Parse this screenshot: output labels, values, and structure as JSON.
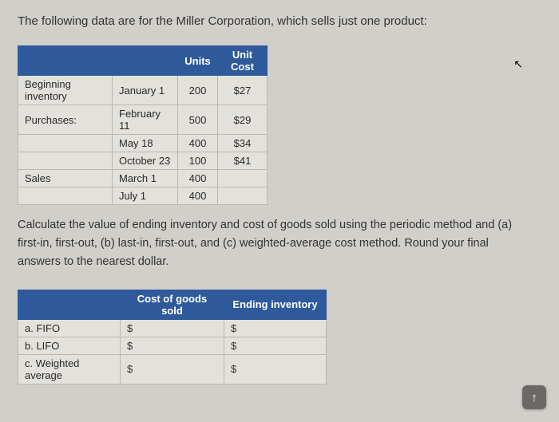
{
  "intro": "The following data are for the Miller Corporation, which sells just one product:",
  "table1": {
    "headers": {
      "units": "Units",
      "unit_cost": "Unit Cost"
    },
    "rows": [
      {
        "label": "Beginning inventory",
        "date": "January 1",
        "units": "200",
        "cost": "$27"
      },
      {
        "label": "Purchases:",
        "date": "February 11",
        "units": "500",
        "cost": "$29"
      },
      {
        "label": "",
        "date": "May 18",
        "units": "400",
        "cost": "$34"
      },
      {
        "label": "",
        "date": "October 23",
        "units": "100",
        "cost": "$41"
      },
      {
        "label": "Sales",
        "date": "March 1",
        "units": "400",
        "cost": ""
      },
      {
        "label": "",
        "date": "July 1",
        "units": "400",
        "cost": ""
      }
    ]
  },
  "question_lines": [
    "Calculate the value of ending inventory and cost of goods sold using the periodic method and (a)",
    "first-in, first-out, (b) last-in, first-out, and (c) weighted-average cost method. Round your final",
    "answers to the nearest dollar."
  ],
  "table2": {
    "headers": {
      "cogs": "Cost of goods sold",
      "ending": "Ending inventory"
    },
    "rows": [
      {
        "label": "a. FIFO",
        "cogs": "$",
        "ending": "$"
      },
      {
        "label": "b. LIFO",
        "cogs": "$",
        "ending": "$"
      },
      {
        "label": "c. Weighted average",
        "cogs": "$",
        "ending": "$"
      }
    ]
  },
  "icons": {
    "cursor": "↖",
    "scroll_top": "↑"
  }
}
